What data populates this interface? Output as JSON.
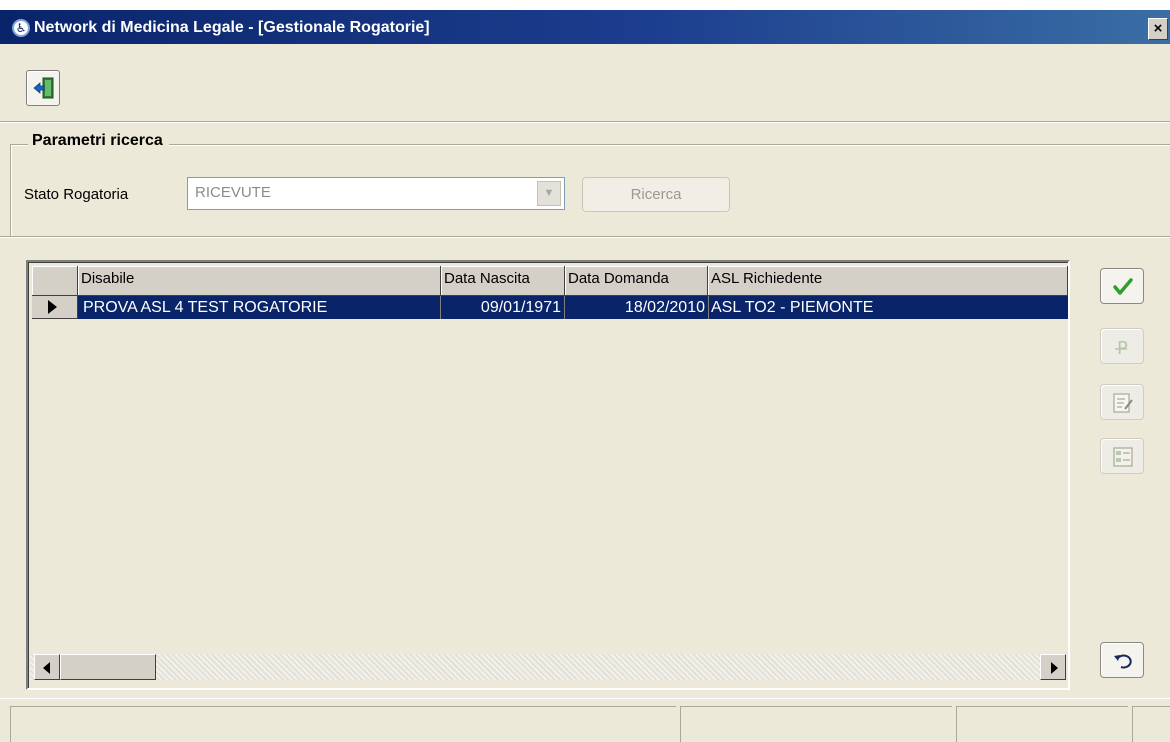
{
  "window": {
    "title": "Network di Medicina Legale - [Gestionale Rogatorie]",
    "close_glyph": "×"
  },
  "toolbar": {
    "exit_icon": "exit-door-icon"
  },
  "search": {
    "group_title": "Parametri ricerca",
    "stato_label": "Stato Rogatoria",
    "stato_value": "RICEVUTE",
    "search_button": "Ricerca"
  },
  "grid": {
    "columns": [
      "Disabile",
      "Data Nascita",
      "Data Domanda",
      "ASL Richiedente"
    ],
    "rows": [
      {
        "disabile": "PROVA ASL 4  TEST ROGATORIE",
        "data_nascita": "09/01/1971",
        "data_domanda": "18/02/2010",
        "asl": "ASL TO2 - PIEMONTE",
        "selected": true
      }
    ]
  },
  "side_buttons": [
    {
      "icon": "checkmark-icon",
      "enabled": true
    },
    {
      "icon": "p-symbol-icon",
      "enabled": false
    },
    {
      "icon": "edit-document-icon",
      "enabled": false
    },
    {
      "icon": "form-icon",
      "enabled": false
    },
    {
      "icon": "undo-icon",
      "enabled": true
    }
  ],
  "colors": {
    "titlebar": "#0a246a",
    "selection": "#0a246a",
    "face": "#ece9d8",
    "check_green": "#2e9e2e"
  }
}
